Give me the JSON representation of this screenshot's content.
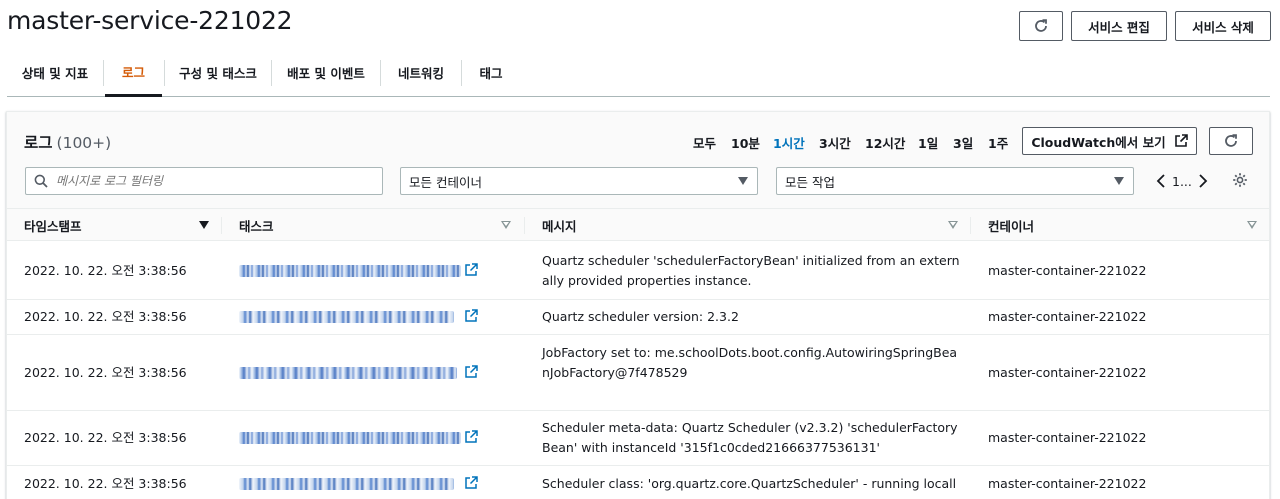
{
  "header": {
    "title": "master-service-221022",
    "edit_label": "서비스 편집",
    "delete_label": "서비스 삭제"
  },
  "tabs": [
    {
      "label": "상태 및 지표"
    },
    {
      "label": "로그"
    },
    {
      "label": "구성 및 태스크"
    },
    {
      "label": "배포 및 이벤트"
    },
    {
      "label": "네트워킹"
    },
    {
      "label": "태그"
    }
  ],
  "logs": {
    "title": "로그",
    "count": "(100+)",
    "ranges": [
      "모두",
      "10분",
      "1시간",
      "3시간",
      "12시간",
      "1일",
      "3일",
      "1주"
    ],
    "active_range": "1시간",
    "cloudwatch_label": "CloudWatch에서 보기",
    "filter_placeholder": "메시지로 로그 필터링",
    "container_select": "모든 컨테이너",
    "task_select": "모든 작업",
    "page": "1..."
  },
  "table": {
    "columns": [
      "타임스탬프",
      "태스크",
      "메시지",
      "컨테이너"
    ],
    "rows": [
      {
        "timestamp": "2022. 10. 22. 오전 3:38:56",
        "message": "Quartz scheduler 'schedulerFactoryBean' initialized from an externally provided properties instance.",
        "container": "master-container-221022"
      },
      {
        "timestamp": "2022. 10. 22. 오전 3:38:56",
        "message": "Quartz scheduler version: 2.3.2",
        "container": "master-container-221022"
      },
      {
        "timestamp": "2022. 10. 22. 오전 3:38:56",
        "message": "JobFactory set to: me.schoolDots.boot.config.AutowiringSpringBeanJobFactory@7f478529",
        "container": "master-container-221022"
      },
      {
        "timestamp": "2022. 10. 22. 오전 3:38:56",
        "message": "Scheduler meta-data: Quartz Scheduler (v2.3.2) 'schedulerFactoryBean' with instanceId '315f1c0cded21666377536131'",
        "container": "master-container-221022"
      },
      {
        "timestamp": "2022. 10. 22. 오전 3:38:56",
        "message": "Scheduler class: 'org.quartz.core.QuartzScheduler' - running locally.",
        "container": "master-container-221022"
      }
    ]
  },
  "colors": {
    "accent_tab": "#d45b07",
    "active_range": "#0073bb",
    "link": "#0073bb"
  }
}
